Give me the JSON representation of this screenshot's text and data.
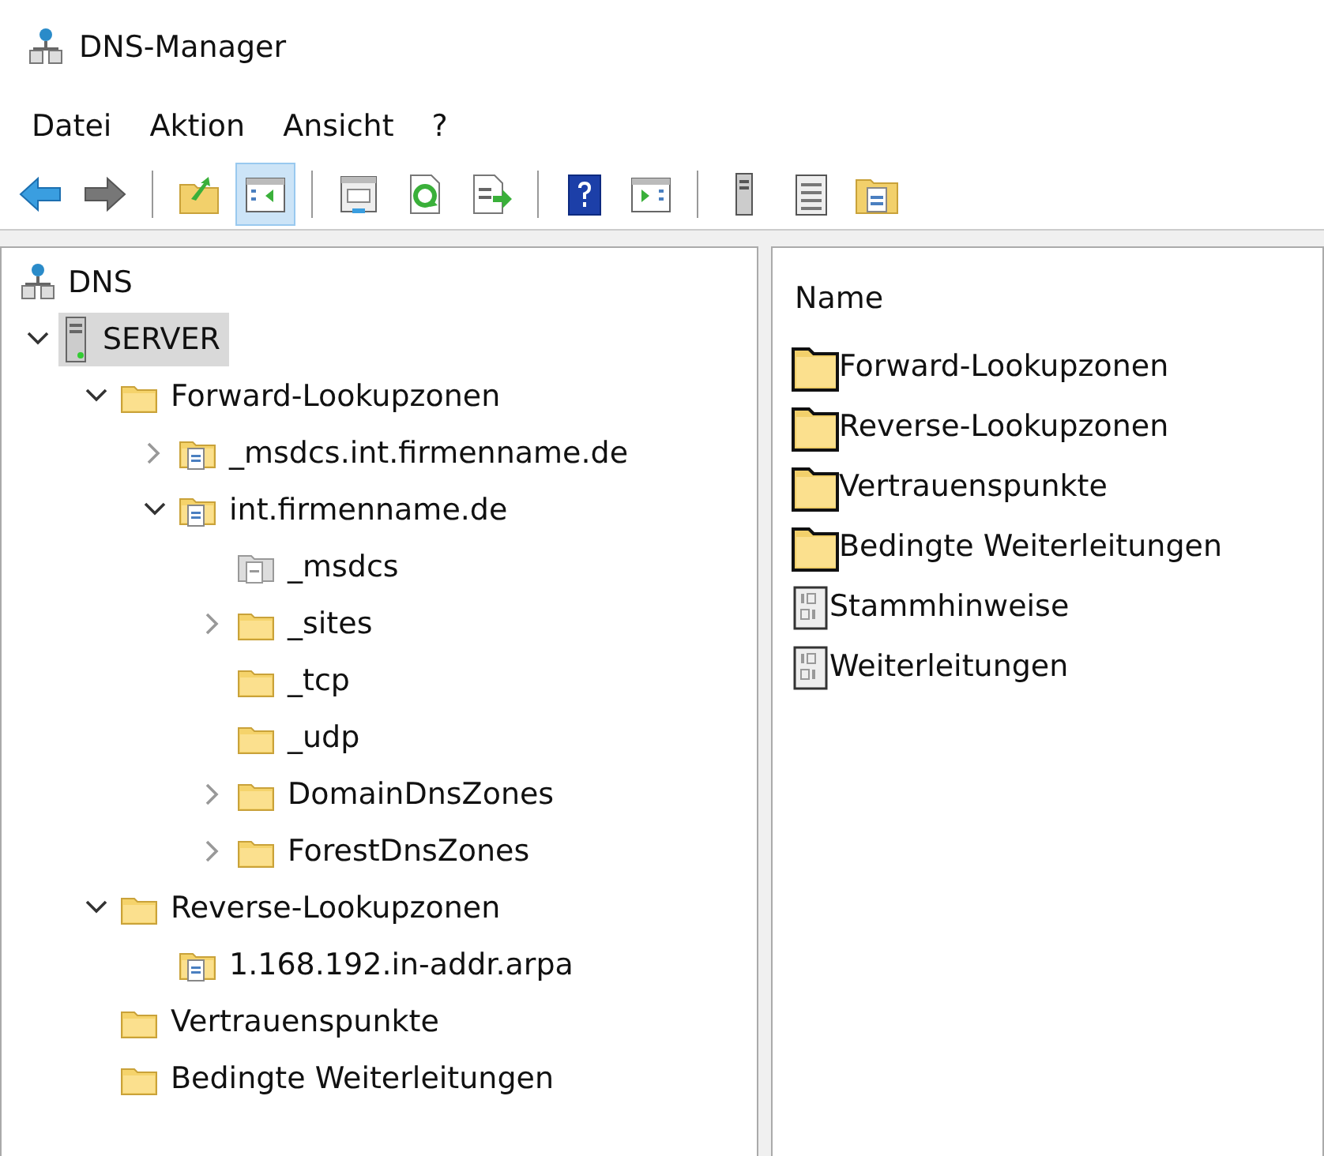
{
  "window": {
    "title": "DNS-Manager"
  },
  "menu": [
    "Datei",
    "Aktion",
    "Ansicht",
    "?"
  ],
  "toolbar": [
    {
      "kind": "back",
      "selected": false
    },
    {
      "kind": "forward",
      "selected": false
    },
    {
      "kind": "separator"
    },
    {
      "kind": "up",
      "selected": false
    },
    {
      "kind": "tree-toggle",
      "selected": true
    },
    {
      "kind": "separator"
    },
    {
      "kind": "properties",
      "selected": false
    },
    {
      "kind": "refresh",
      "selected": false
    },
    {
      "kind": "export",
      "selected": false
    },
    {
      "kind": "separator"
    },
    {
      "kind": "help",
      "selected": false
    },
    {
      "kind": "action-pane",
      "selected": false
    },
    {
      "kind": "separator"
    },
    {
      "kind": "server",
      "selected": false
    },
    {
      "kind": "records",
      "selected": false
    },
    {
      "kind": "zone",
      "selected": false
    }
  ],
  "tree": [
    {
      "label": "DNS",
      "kind": "network",
      "selected": false
    },
    {
      "label": "SERVER",
      "kind": "server",
      "selected": true,
      "expanded": true,
      "children": [
        {
          "label": "Forward-Lookupzonen",
          "kind": "folder",
          "selected": false,
          "expanded": true,
          "children": [
            {
              "label": "_msdcs.int.firmenname.de",
              "kind": "zone",
              "selected": false,
              "expanded": false
            },
            {
              "label": "int.firmenname.de",
              "kind": "zone",
              "selected": false,
              "expanded": true,
              "children": [
                {
                  "label": "_msdcs",
                  "kind": "delegation",
                  "selected": false
                },
                {
                  "label": "_sites",
                  "kind": "folder",
                  "selected": false,
                  "expanded": false
                },
                {
                  "label": "_tcp",
                  "kind": "folder",
                  "selected": false
                },
                {
                  "label": "_udp",
                  "kind": "folder",
                  "selected": false
                },
                {
                  "label": "DomainDnsZones",
                  "kind": "folder",
                  "selected": false,
                  "expanded": false
                },
                {
                  "label": "ForestDnsZones",
                  "kind": "folder",
                  "selected": false,
                  "expanded": false
                }
              ]
            }
          ]
        },
        {
          "label": "Reverse-Lookupzonen",
          "kind": "folder",
          "selected": false,
          "expanded": true,
          "children": [
            {
              "label": "1.168.192.in-addr.arpa",
              "kind": "zone",
              "selected": false
            }
          ]
        },
        {
          "label": "Vertrauenspunkte",
          "kind": "folder",
          "selected": false
        },
        {
          "label": "Bedingte Weiterleitungen",
          "kind": "folder",
          "selected": false
        }
      ]
    }
  ],
  "list": {
    "column": "Name",
    "items": [
      {
        "label": "Forward-Lookupzonen",
        "kind": "folder"
      },
      {
        "label": "Reverse-Lookupzonen",
        "kind": "folder"
      },
      {
        "label": "Vertrauenspunkte",
        "kind": "folder"
      },
      {
        "label": "Bedingte Weiterleitungen",
        "kind": "folder"
      },
      {
        "label": "Stammhinweise",
        "kind": "binary"
      },
      {
        "label": "Weiterleitungen",
        "kind": "binary"
      }
    ]
  }
}
